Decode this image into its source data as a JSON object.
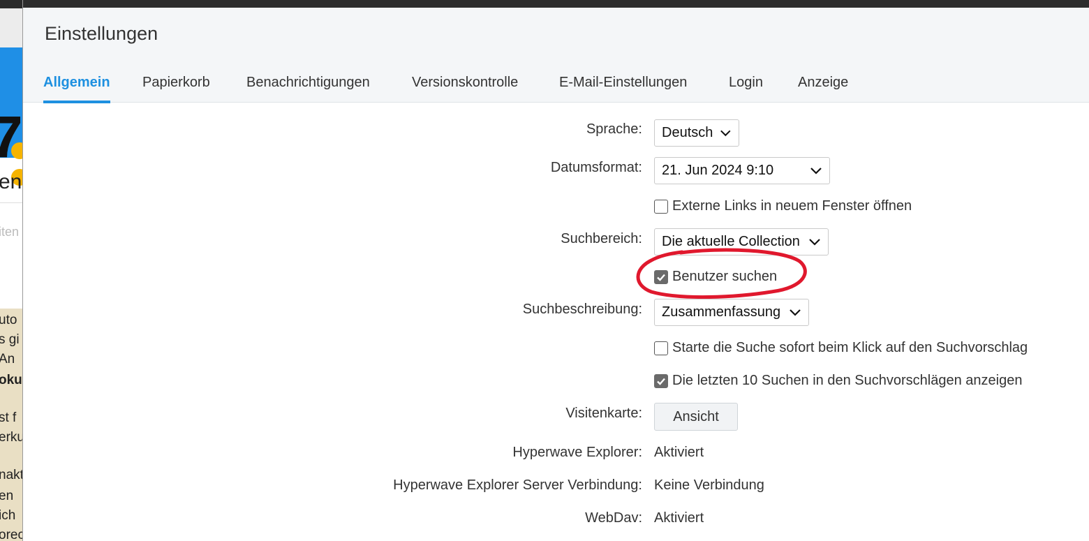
{
  "background": {
    "heading_fragment": "en",
    "faint_fragment": "iten",
    "number_fragment": "7",
    "panel_lines": [
      "uto",
      "s gi",
      " An",
      "oku",
      "",
      "st f",
      "erku",
      "",
      "nakt",
      "en",
      "ich",
      "orec"
    ]
  },
  "dialog": {
    "title": "Einstellungen",
    "tabs": [
      {
        "label": "Allgemein",
        "active": true
      },
      {
        "label": "Papierkorb",
        "active": false
      },
      {
        "label": "Benachrichtigungen",
        "active": false
      },
      {
        "label": "Versionskontrolle",
        "active": false
      },
      {
        "label": "E-Mail-Einstellungen",
        "active": false
      },
      {
        "label": "Login",
        "active": false
      },
      {
        "label": "Anzeige",
        "active": false
      }
    ]
  },
  "form": {
    "language": {
      "label": "Sprache:",
      "value": "Deutsch"
    },
    "date_format": {
      "label": "Datumsformat:",
      "value": "21. Jun 2024 9:10"
    },
    "external_links": {
      "label": "Externe Links in neuem Fenster öffnen",
      "checked": false
    },
    "search_scope": {
      "label": "Suchbereich:",
      "value": "Die aktuelle Collection"
    },
    "search_users": {
      "label": "Benutzer suchen",
      "checked": true
    },
    "search_description": {
      "label": "Suchbeschreibung:",
      "value": "Zusammenfassung"
    },
    "instant_search": {
      "label": "Starte die Suche sofort beim Klick auf den Suchvorschlag",
      "checked": false
    },
    "recent_searches": {
      "label": "Die letzten 10 Suchen in den Suchvorschlägen anzeigen",
      "checked": true
    },
    "business_card": {
      "label": "Visitenkarte:",
      "button": "Ansicht"
    },
    "hw_explorer": {
      "label": "Hyperwave Explorer:",
      "value": "Aktiviert"
    },
    "hw_server": {
      "label": "Hyperwave Explorer Server Verbindung:",
      "value": "Keine Verbindung"
    },
    "webdav": {
      "label": "WebDav:",
      "value": "Aktiviert"
    }
  },
  "colors": {
    "accent": "#1e90e0",
    "highlight_ring": "#e0182d"
  }
}
